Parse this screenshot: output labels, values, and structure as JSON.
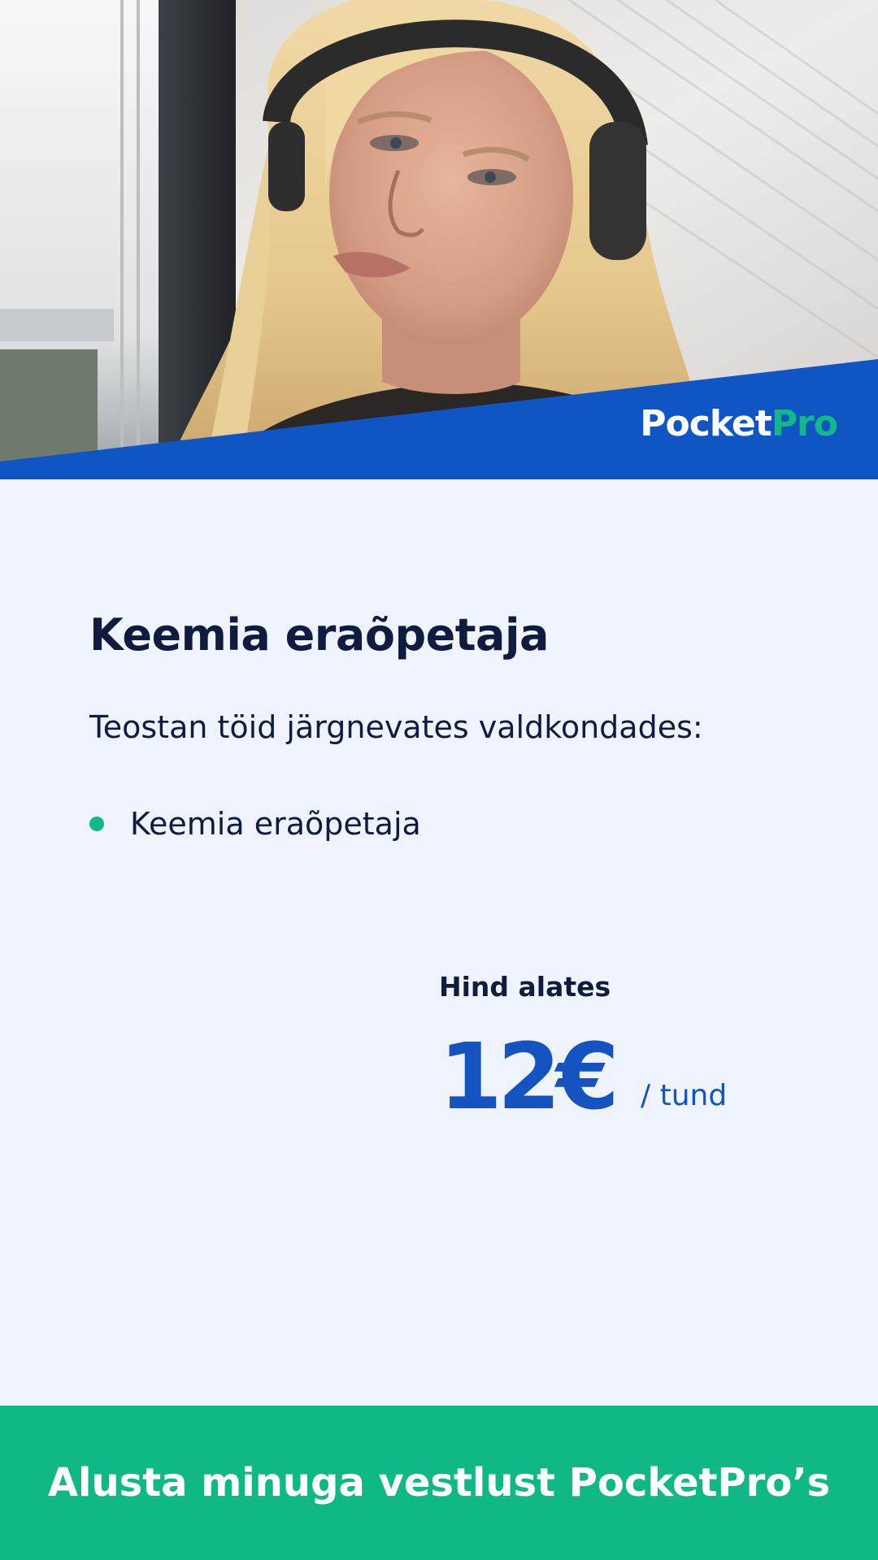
{
  "hero": {
    "photo_alt": "tutor-portrait",
    "brand": {
      "name_part1": "Pocket",
      "name_part2": "Pro",
      "band_color": "#0f55c4",
      "accent_color": "#12b886"
    }
  },
  "profile": {
    "title": "Keemia eraõpetaja",
    "intro": "Teostan töid järgnevates valdkondades:",
    "services": [
      "Keemia eraõpetaja"
    ]
  },
  "price": {
    "label": "Hind alates",
    "amount": "12€",
    "unit": "/ tund",
    "color": "#1553c0"
  },
  "cta": {
    "label": "Alusta minuga vestlust PocketPro’s",
    "color": "#10b886"
  }
}
